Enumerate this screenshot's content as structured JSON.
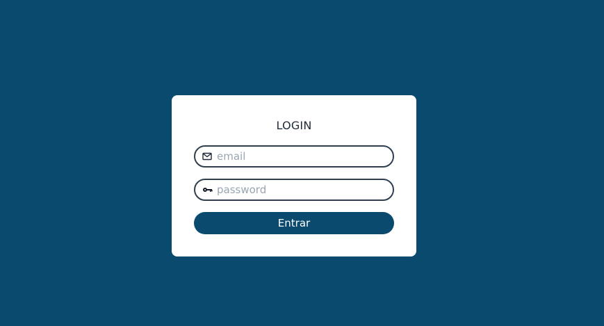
{
  "login": {
    "title": "LOGIN",
    "email_placeholder": "email",
    "password_placeholder": "password",
    "submit_label": "Entrar",
    "email_icon": "envelope-icon",
    "password_icon": "key-icon"
  },
  "colors": {
    "background": "#0b4a6f",
    "card": "#ffffff",
    "button": "#0b4a6f",
    "input_border": "#2f3e4e",
    "placeholder": "#9aa5b1"
  }
}
